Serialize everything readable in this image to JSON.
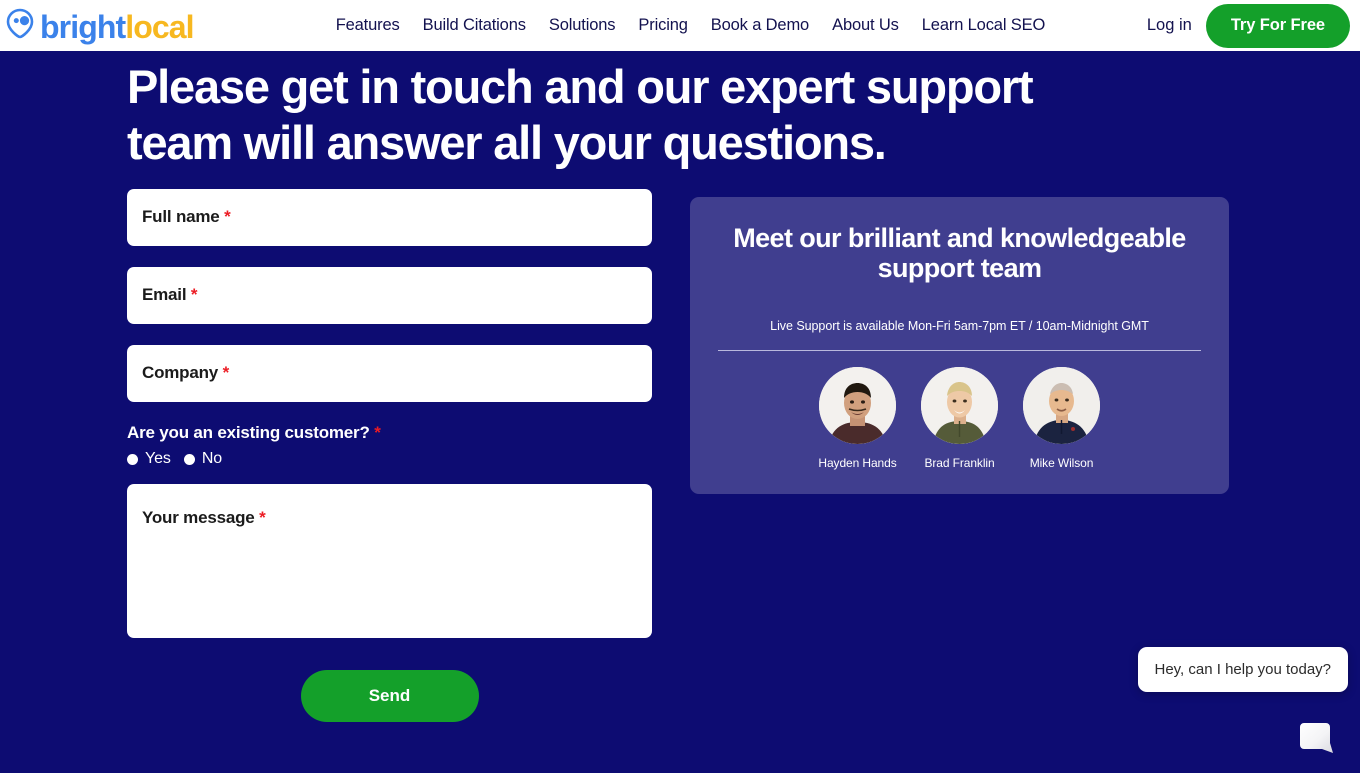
{
  "header": {
    "logo": {
      "icon": "location-pin-icon",
      "text_primary": "bright",
      "text_secondary": "local"
    },
    "nav_items": [
      {
        "label": "Features"
      },
      {
        "label": "Build Citations"
      },
      {
        "label": "Solutions"
      },
      {
        "label": "Pricing"
      },
      {
        "label": "Book a Demo"
      },
      {
        "label": "About Us"
      },
      {
        "label": "Learn Local SEO"
      }
    ],
    "login_label": "Log in",
    "cta_label": "Try For Free",
    "cta_color": "#14a02a"
  },
  "hero": {
    "headline": "Please get in touch and our expert support team will answer all your questions."
  },
  "form": {
    "fields": [
      {
        "label": "Full name",
        "required_marker": "*",
        "value": "",
        "placeholder": ""
      },
      {
        "label": "Email",
        "required_marker": "*",
        "value": "",
        "placeholder": ""
      },
      {
        "label": "Company",
        "required_marker": "*",
        "value": "",
        "placeholder": ""
      }
    ],
    "radio_group": {
      "question": "Are you an existing customer?",
      "required_marker": "*",
      "options": [
        {
          "label": "Yes",
          "selected": false
        },
        {
          "label": "No",
          "selected": false
        }
      ]
    },
    "message": {
      "label": "Your message",
      "required_marker": "*",
      "value": "",
      "placeholder": ""
    },
    "submit_label": "Send"
  },
  "support_card": {
    "title": "Meet our brilliant and knowledgeable support team",
    "hours": "Live Support is available Mon-Fri 5am-7pm ET / 10am-Midnight GMT",
    "background_color": "#403e8f",
    "team": [
      {
        "name": "Hayden Hands"
      },
      {
        "name": "Brad Franklin"
      },
      {
        "name": "Mike Wilson"
      }
    ]
  },
  "chat_widget": {
    "message": "Hey, can I help you today?",
    "launcher_icon": "chat-bubble-icon"
  },
  "theme": {
    "page_background": "#0d0c72",
    "accent_green": "#14a02a",
    "required_red": "#ec1c24",
    "logo_blue": "#3b82ea",
    "logo_yellow": "#f7b820"
  }
}
